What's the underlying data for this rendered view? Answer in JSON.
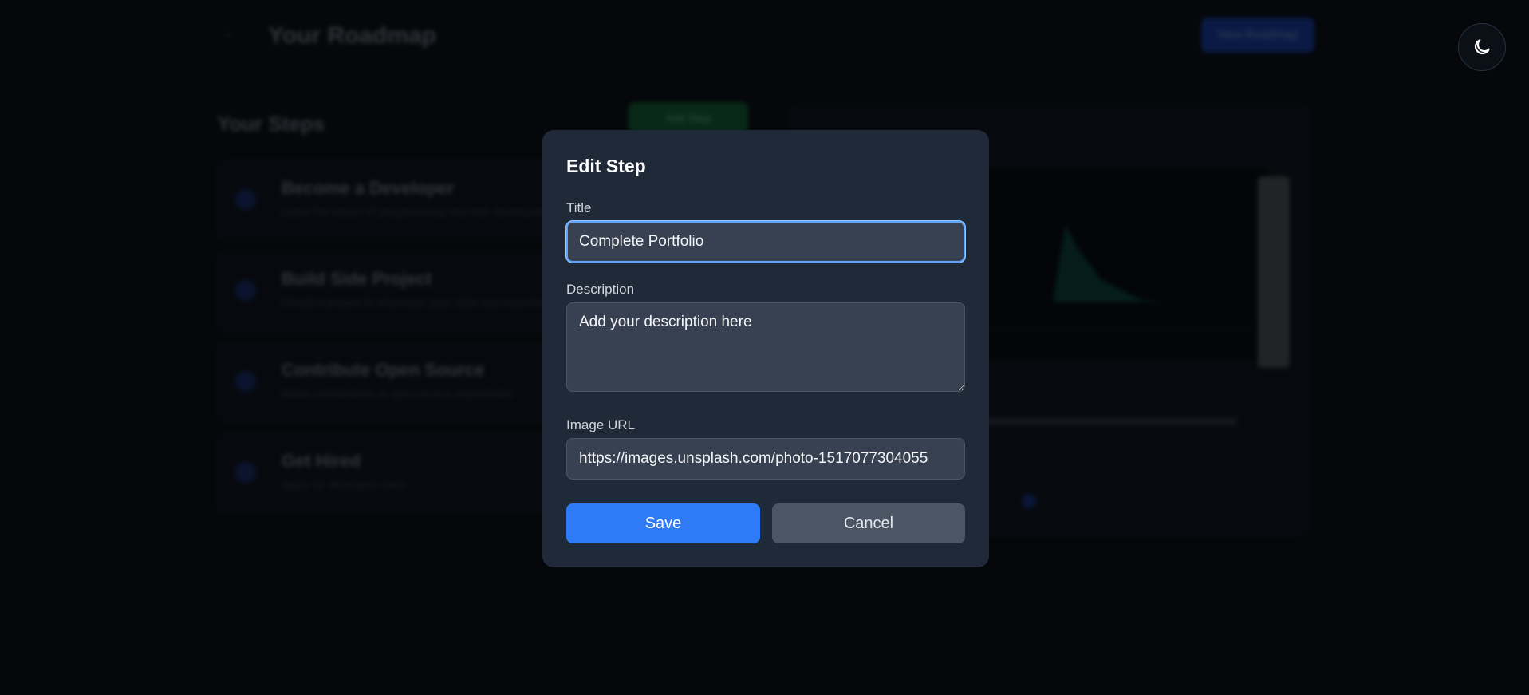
{
  "background": {
    "page_title": "Your Roadmap",
    "new_button_label": "New Roadmap",
    "steps_heading": "Your Steps",
    "green_badge_label": "Add Step",
    "steps": [
      {
        "title": "Become a Developer",
        "subtitle": "Learn the basics of programming and web development"
      },
      {
        "title": "Build Side Project",
        "subtitle": "Create a project to showcase your skills and experience"
      },
      {
        "title": "Contribute Open Source",
        "subtitle": "Make contributions to open source repositories"
      },
      {
        "title": "Get Hired",
        "subtitle": "Apply for developer roles"
      }
    ]
  },
  "theme_toggle": {
    "icon": "moon-icon"
  },
  "modal": {
    "title": "Edit Step",
    "title_field": {
      "label": "Title",
      "value": "Complete Portfolio"
    },
    "description_field": {
      "label": "Description",
      "placeholder": "Add your description here"
    },
    "image_url_field": {
      "label": "Image URL",
      "value": "https://images.unsplash.com/photo-1517077304055"
    },
    "save_label": "Save",
    "cancel_label": "Cancel"
  },
  "colors": {
    "accent": "#2f7bf6",
    "modal_bg": "#1f2937",
    "input_bg": "#374151",
    "focus_ring": "#60a5fa"
  }
}
